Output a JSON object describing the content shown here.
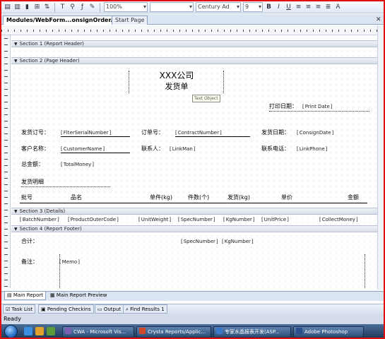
{
  "toolbar": {
    "zoom": "100%",
    "style_combo": "",
    "font_name": "Century Ad",
    "font_size": "9"
  },
  "tabs": [
    {
      "label": "Modules/WebForm...onsignOrder.rpt*"
    },
    {
      "label": "Start Page"
    }
  ],
  "sections": {
    "s1": "Section 1 (Report Header)",
    "s2": "Section 2 (Page Header)",
    "s3": "Section 3 (Details)",
    "s4": "Section 4 (Report Footer)"
  },
  "page_header": {
    "title": "XXX公司",
    "subtitle": "发货单",
    "tooltip": "Text Object",
    "print_date_label": "打印日期：",
    "print_date_field": "Print Date",
    "order_no_label": "发货订号：",
    "order_no_field": "FlterSerialNumber",
    "contract_label": "订单号：",
    "contract_field": "ContractNumber",
    "ship_date_label": "发货日期：",
    "ship_date_field": "ConsignDate",
    "client_label": "客户名称：",
    "client_field": "CustomerName",
    "contact_label": "联系人：",
    "contact_field": "LinkMan",
    "phone_label": "联系电话：",
    "phone_field": "LinkPhone",
    "total_label": "总金额：",
    "total_field": "TotalMoney",
    "detail_label": "发货明细",
    "columns": [
      "批号",
      "品名",
      "单件(kg)",
      "件数(个)",
      "发货(kg)",
      "单价",
      "金额"
    ]
  },
  "details": {
    "fields": [
      "BatchNumber",
      "ProductOuterCode",
      "UnitWeight",
      "SpecNumber",
      "KgNumber",
      "UnitPrice",
      "CollectMoney"
    ]
  },
  "footer": {
    "sum_label": "合计：",
    "spec_sum_field": "SpecNumber",
    "kg_sum_field": "KgNumber",
    "memo_label": "备注：",
    "memo_field": "Memo"
  },
  "view_tabs": [
    {
      "label": "Main Report"
    },
    {
      "label": "Main Report Preview"
    }
  ],
  "panes": [
    {
      "label": "Task List"
    },
    {
      "label": "Pending Checkins"
    },
    {
      "label": "Output"
    },
    {
      "label": "Find Results 1"
    }
  ],
  "status": "Ready",
  "taskbar": [
    {
      "label": "CWA - Microsoft Vis...",
      "color": "#7b5fb0"
    },
    {
      "label": "Crysta Reports/Applic...",
      "color": "#d04a2a"
    },
    {
      "label": "专家水晶报表开发(ASP...",
      "color": "#3a78c8"
    },
    {
      "label": "Adobe Photoshop",
      "color": "#2a4f8f"
    }
  ]
}
